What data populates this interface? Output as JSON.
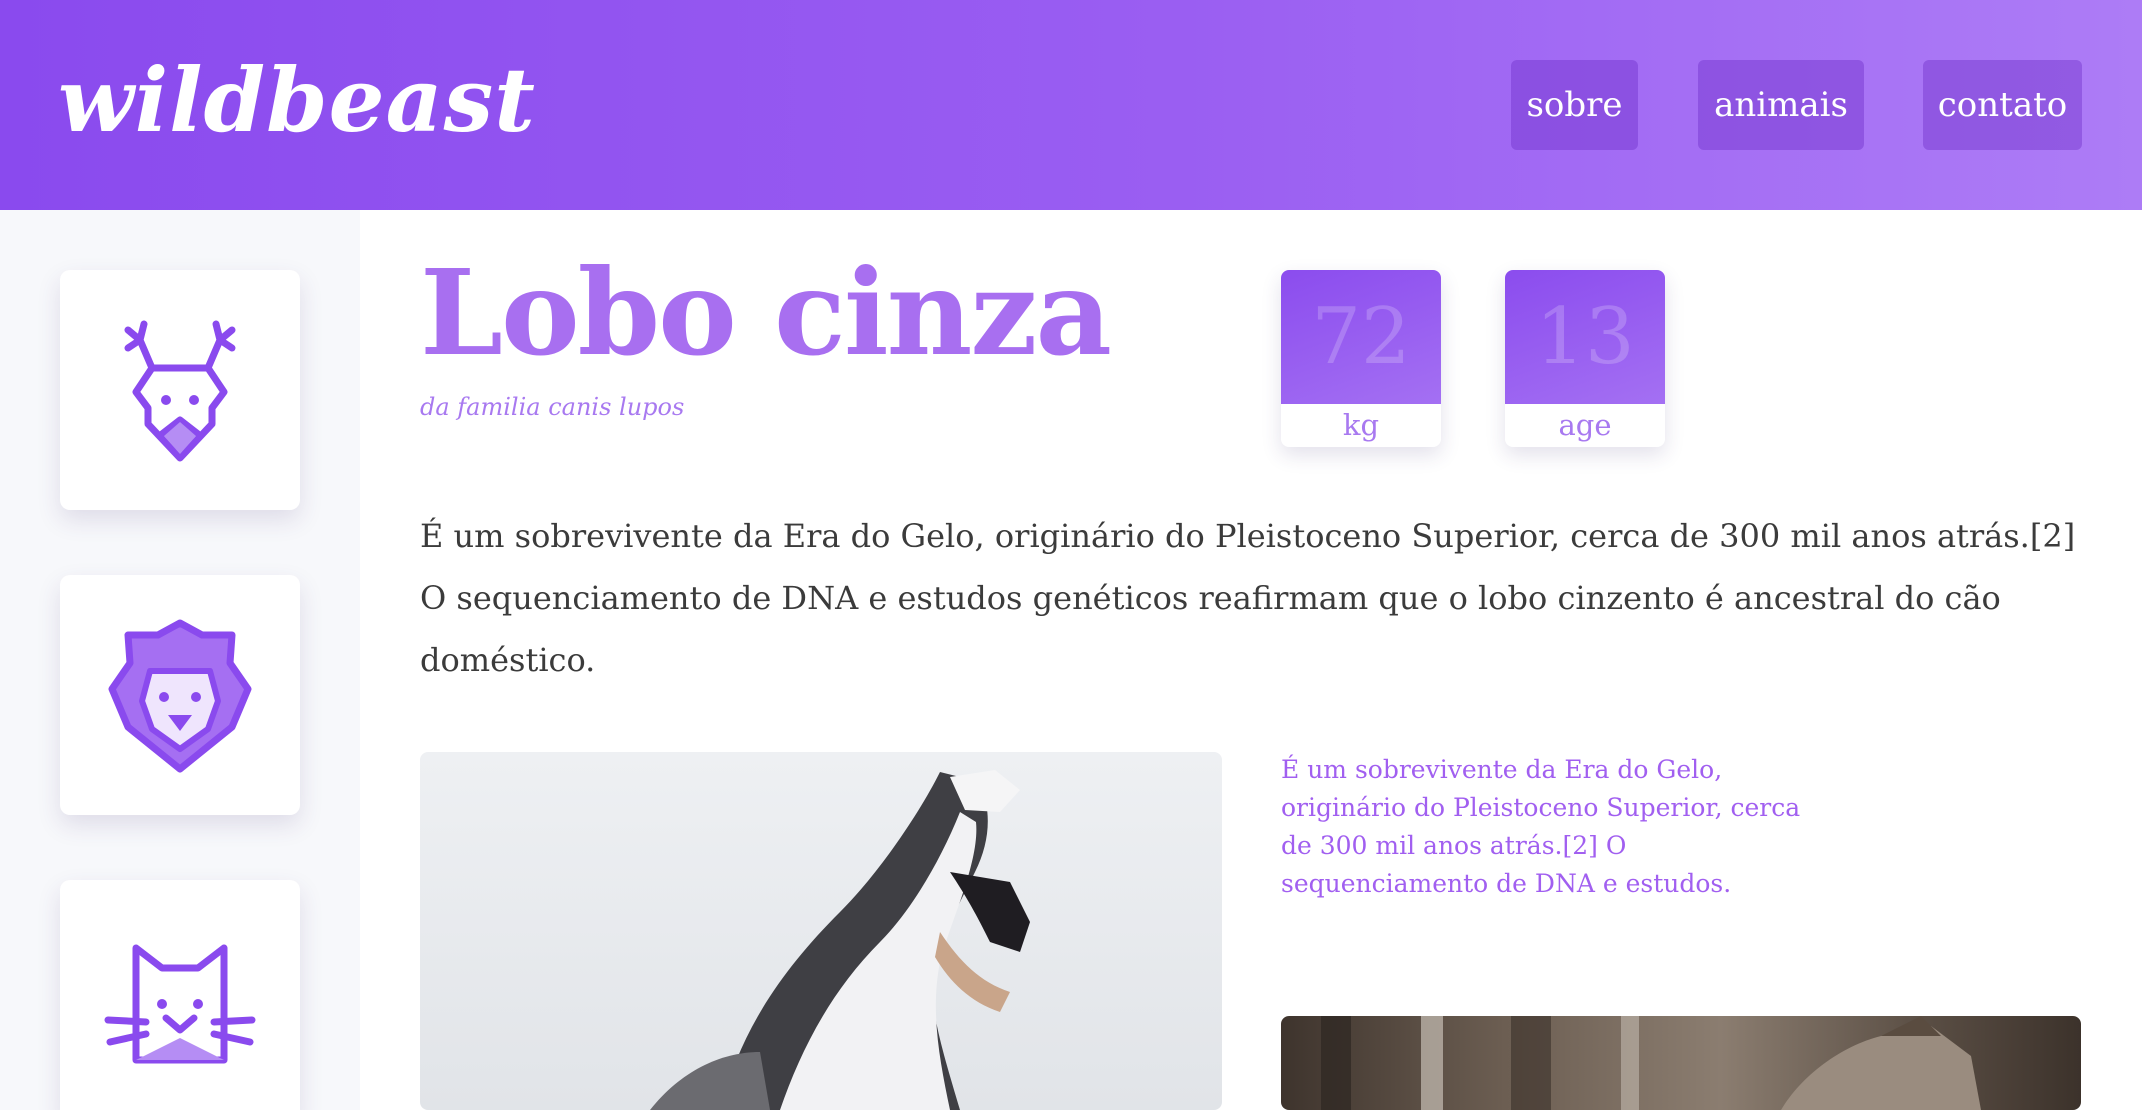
{
  "header": {
    "logo": "wildbeast",
    "nav": [
      {
        "label": "sobre"
      },
      {
        "label": "animais"
      },
      {
        "label": "contato"
      }
    ]
  },
  "sidebar": {
    "items": [
      {
        "icon": "deer-icon"
      },
      {
        "icon": "lion-icon"
      },
      {
        "icon": "cat-icon"
      }
    ]
  },
  "main": {
    "title": "Lobo cinza",
    "subtitle": "da familia canis lupos",
    "stats": [
      {
        "value": "72",
        "label": "kg"
      },
      {
        "value": "13",
        "label": "age"
      }
    ],
    "description": "É um sobrevivente da Era do Gelo, originário do Pleistoceno Superior, cerca de 300 mil anos atrás.[2] O sequenciamento de DNA e estudos genéticos reafirmam que o lobo cinzento é ancestral do cão doméstico.",
    "caption": "É um sobrevivente da Era do Gelo, originário do Pleistoceno Superior, cerca de 300 mil anos atrás.[2] O sequenciamento de DNA e estudos."
  },
  "colors": {
    "accent": "#8a4aee",
    "accent_light": "#a879f0",
    "text": "#3b3b3b",
    "sidebar_bg": "#f7f8fb"
  }
}
